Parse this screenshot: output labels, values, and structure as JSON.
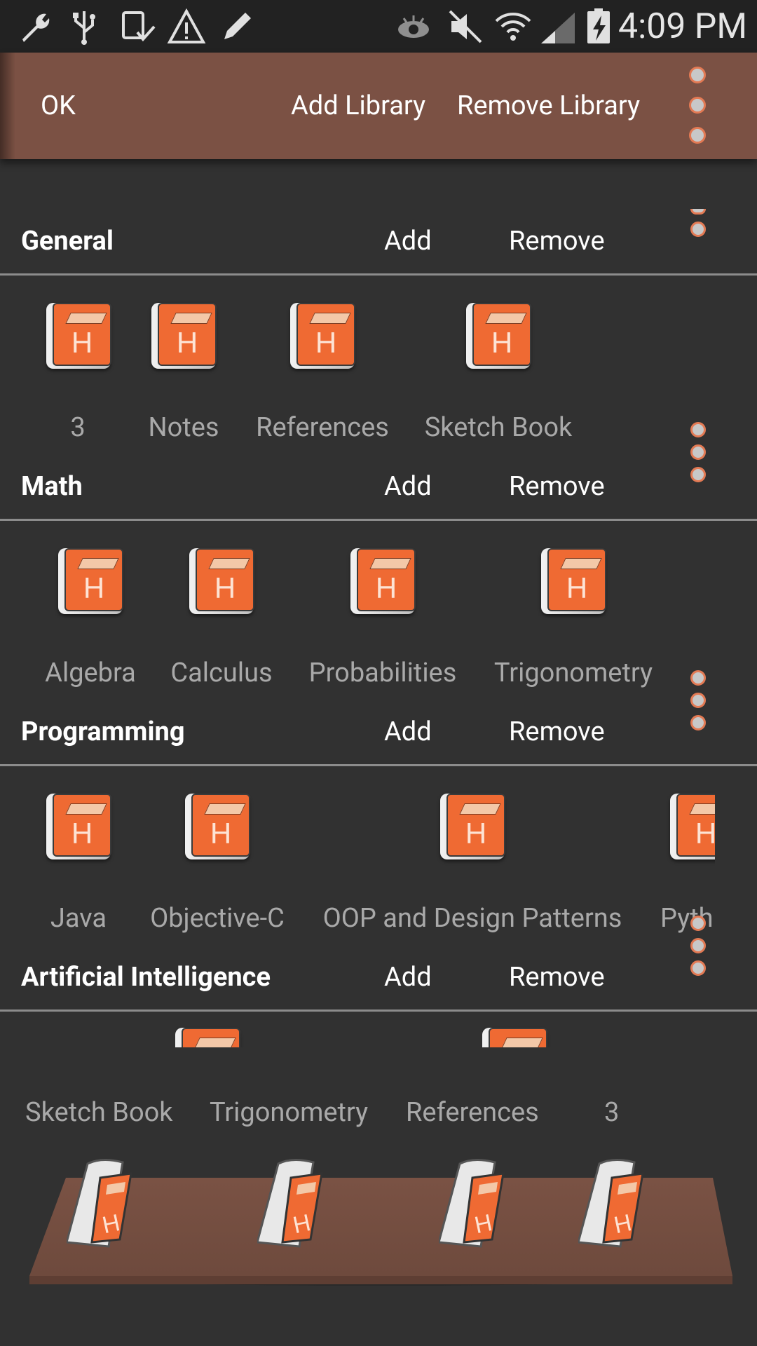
{
  "status_bar": {
    "time": "4:09 PM",
    "left_icons": [
      "wrench-icon",
      "usb-icon",
      "download-done-icon",
      "warning-icon",
      "pencil-icon"
    ],
    "right_icons": [
      "eye-icon",
      "mute-icon",
      "wifi-icon",
      "signal-icon",
      "battery-charging-icon"
    ]
  },
  "action_bar": {
    "ok_label": "OK",
    "add_library_label": "Add Library",
    "remove_library_label": "Remove Library"
  },
  "sections": [
    {
      "title": "General",
      "add_label": "Add",
      "remove_label": "Remove",
      "books": [
        "3",
        "Notes",
        "References",
        "Sketch Book"
      ]
    },
    {
      "title": "Math",
      "add_label": "Add",
      "remove_label": "Remove",
      "books": [
        "Algebra",
        "Calculus",
        "Probabilities",
        "Trigonometry"
      ]
    },
    {
      "title": "Programming",
      "add_label": "Add",
      "remove_label": "Remove",
      "books": [
        "Java",
        "Objective-C",
        "OOP and Design Patterns",
        "Pyth"
      ]
    },
    {
      "title": "Artificial Intelligence",
      "add_label": "Add",
      "remove_label": "Remove",
      "books": []
    }
  ],
  "shelf": {
    "books": [
      "Sketch Book",
      "Trigonometry",
      "References",
      "3"
    ]
  },
  "book_icon_letter": "H",
  "colors": {
    "accent_brown": "#7b5144",
    "book_orange": "#ef6a33",
    "background": "#313131"
  }
}
